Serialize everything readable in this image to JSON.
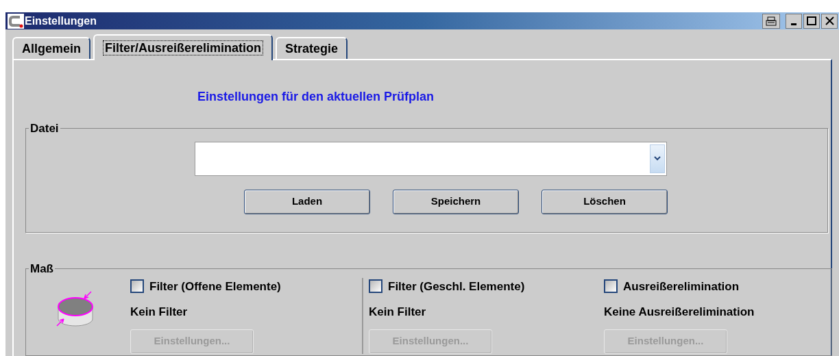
{
  "window": {
    "title": "Einstellungen"
  },
  "tabs": [
    {
      "label": "Allgemein",
      "selected": false
    },
    {
      "label": "Filter/Ausreißerelimination",
      "selected": true
    },
    {
      "label": "Strategie",
      "selected": false
    }
  ],
  "heading": "Einstellungen für den aktuellen Prüfplan",
  "datei": {
    "legend": "Datei",
    "buttons": [
      {
        "label": "Laden",
        "disabled": false
      },
      {
        "label": "Speichern",
        "disabled": false
      },
      {
        "label": "Löschen",
        "disabled": false
      }
    ]
  },
  "mass": {
    "legend": "Maß",
    "columns": [
      {
        "checkbox": {
          "label": "Filter (Offene Elemente)",
          "checked": false
        },
        "status": "Kein Filter",
        "button": {
          "label": "Einstellungen...",
          "disabled": true
        }
      },
      {
        "checkbox": {
          "label": "Filter (Geschl. Elemente)",
          "checked": false
        },
        "status": "Kein Filter",
        "button": {
          "label": "Einstellungen...",
          "disabled": true
        }
      },
      {
        "checkbox": {
          "label": "Ausreißerelimination",
          "checked": false
        },
        "status": "Keine Ausreißerelimination",
        "button": {
          "label": "Einstellungen...",
          "disabled": true
        }
      }
    ]
  }
}
